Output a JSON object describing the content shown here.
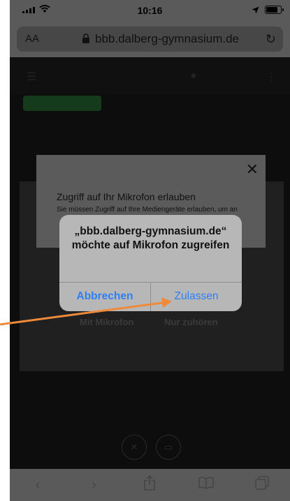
{
  "status_bar": {
    "time": "10:16"
  },
  "url_bar": {
    "text_size_label": "AA",
    "url": "bbb.dalberg-gymnasium.de"
  },
  "audio_modal": {
    "title": "Zugriff auf Ihr Mikrofon erlauben",
    "subtitle": "Sie müssen Zugriff auf Ihre Mediengeräte erlauben, um an"
  },
  "permission_alert": {
    "title": "„bbb.dalberg-gymnasium.de“ möchte auf Mikrofon zugreifen",
    "cancel_label": "Abbrechen",
    "allow_label": "Zulassen"
  },
  "audio_options": {
    "microphone_label": "Mit Mikrofon",
    "listen_only_label": "Nur zuhören"
  },
  "toolbar": {
    "icons": [
      "back-icon",
      "forward-icon",
      "share-icon",
      "bookmarks-icon",
      "tabs-icon"
    ]
  },
  "colors": {
    "accent": "#2f7ff7",
    "annotation_arrow": "#ee8a3a"
  }
}
